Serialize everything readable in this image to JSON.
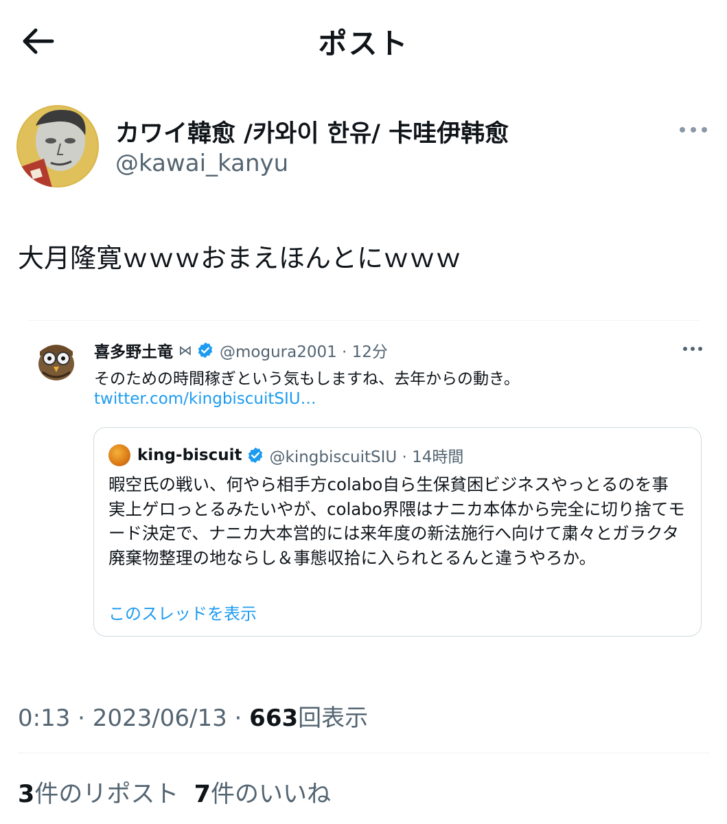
{
  "header": {
    "title": "ポスト",
    "back_icon": "arrow-left-icon"
  },
  "author": {
    "display_name": "カワイ韓愈 /카와이 한유/ 卡哇伊韩愈",
    "handle": "@kawai_kanyu"
  },
  "post": {
    "text": "大月隆寛ｗｗｗおまえほんとにｗｗｗ"
  },
  "quoted": {
    "display_name": "喜多野土竜",
    "bowtie_icon": "⋈",
    "handle_time": "@mogura2001 · 12分",
    "text": "そのための時間稼ぎという気もしますね、去年からの動き。",
    "link": "twitter.com/kingbiscuitSIU…",
    "card": {
      "display_name": "king-biscuit",
      "handle_time": "@kingbiscuitSIU · 14時間",
      "text": "暇空氏の戦い、何やら相手方colabo自ら生保貧困ビジネスやっとるのを事実上ゲロっとるみたいやが、colabo界隈はナニカ本体から完全に切り捨てモード決定で、ナニカ大本営的には来年度の新法施行へ向けて粛々とガラクタ廃棄物整理の地ならし＆事態収拾に入られとるんと違うやろか。",
      "show_thread": "このスレッドを表示"
    }
  },
  "meta": {
    "time_date": "0:13 · 2023/06/13 · ",
    "views_count": "663",
    "views_label": "回表示"
  },
  "stats": {
    "reposts_count": "3",
    "reposts_label": "件のリポスト",
    "likes_count": "7",
    "likes_label": "件のいいね"
  },
  "colors": {
    "link": "#1d9bf0",
    "secondary": "#536471",
    "verified": "#1d9bf0"
  }
}
